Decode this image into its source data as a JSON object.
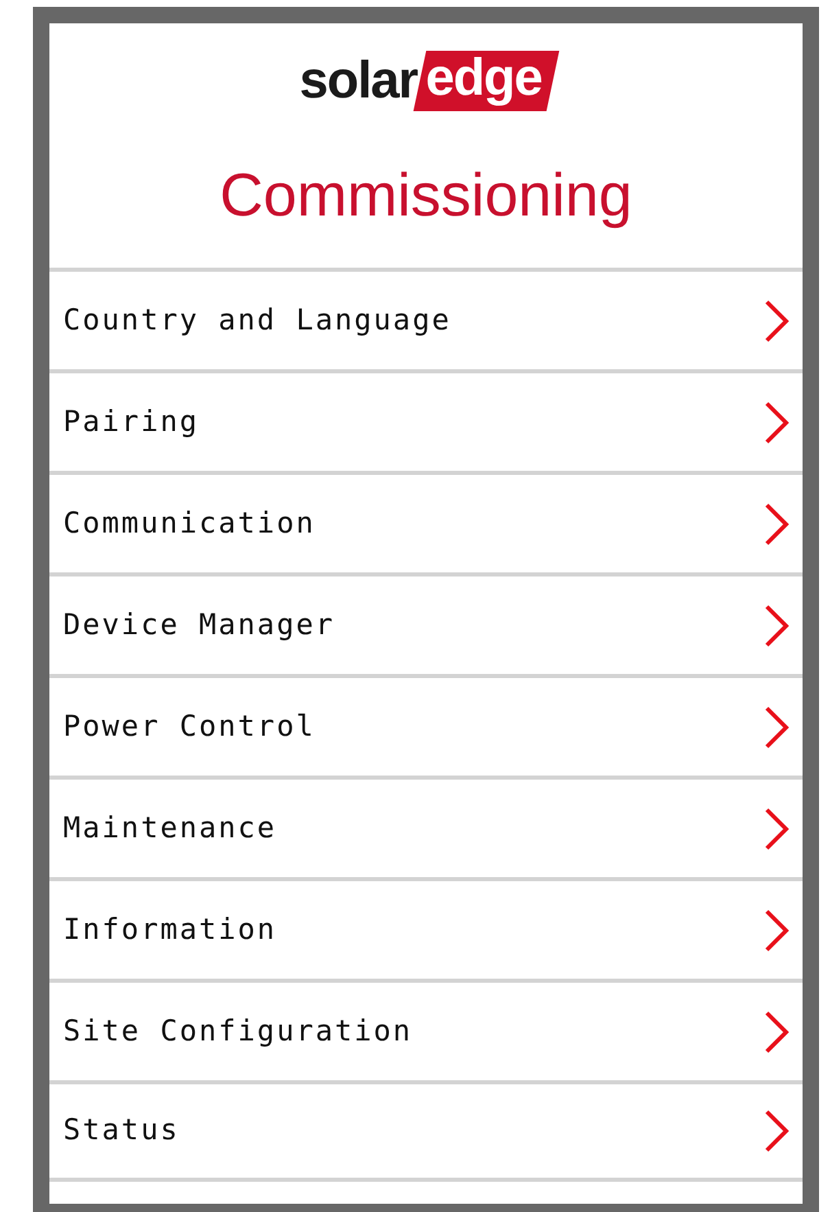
{
  "logo": {
    "dark_part": "solar",
    "red_part": "edge"
  },
  "title": "Commissioning",
  "menu_items": [
    {
      "label": "Country and Language"
    },
    {
      "label": "Pairing"
    },
    {
      "label": "Communication"
    },
    {
      "label": "Device Manager"
    },
    {
      "label": "Power Control"
    },
    {
      "label": "Maintenance"
    },
    {
      "label": "Information"
    },
    {
      "label": "Site Configuration"
    },
    {
      "label": "Status"
    }
  ]
}
